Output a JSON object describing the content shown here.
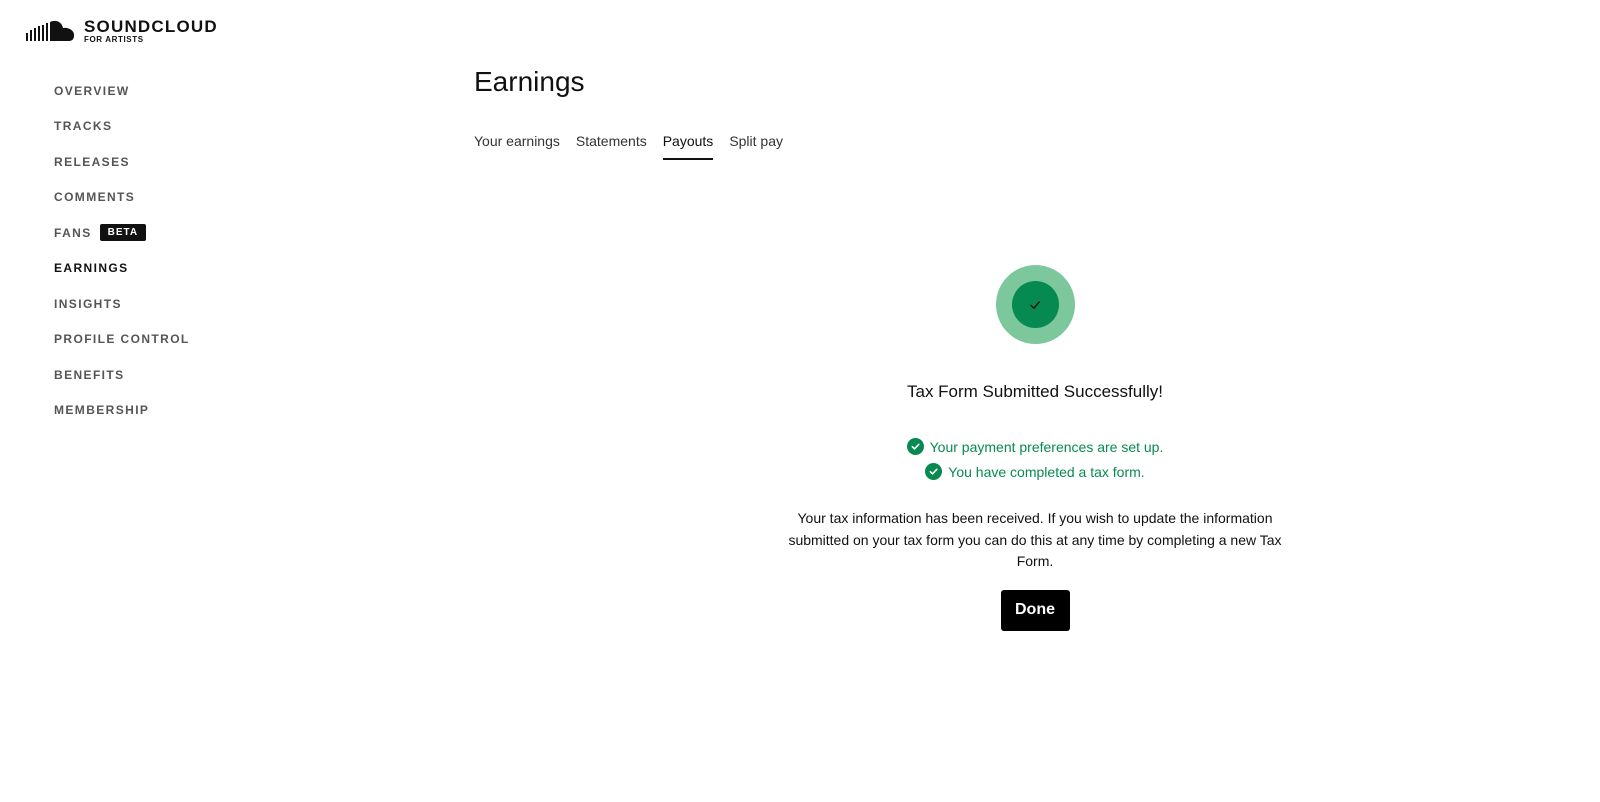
{
  "brand": {
    "logo_icon": "soundcloud-cloud-icon",
    "name": "SOUNDCLOUD",
    "subtitle": "FOR ARTISTS"
  },
  "sidebar": {
    "items": [
      {
        "label": "OVERVIEW",
        "active": false
      },
      {
        "label": "TRACKS",
        "active": false
      },
      {
        "label": "RELEASES",
        "active": false
      },
      {
        "label": "COMMENTS",
        "active": false
      },
      {
        "label": "FANS",
        "active": false,
        "badge": "BETA"
      },
      {
        "label": "EARNINGS",
        "active": true
      },
      {
        "label": "INSIGHTS",
        "active": false
      },
      {
        "label": "PROFILE CONTROL",
        "active": false
      },
      {
        "label": "BENEFITS",
        "active": false
      },
      {
        "label": "MEMBERSHIP",
        "active": false
      }
    ]
  },
  "main": {
    "title": "Earnings",
    "tabs": [
      {
        "label": "Your earnings",
        "active": false
      },
      {
        "label": "Statements",
        "active": false
      },
      {
        "label": "Payouts",
        "active": true
      },
      {
        "label": "Split pay",
        "active": false
      }
    ],
    "success": {
      "icon": "check-icon",
      "title": "Tax Form Submitted Successfully!",
      "status_items": [
        {
          "icon": "check-circle-icon",
          "text": "Your payment preferences are set up."
        },
        {
          "icon": "check-circle-icon",
          "text": "You have completed a tax form."
        }
      ],
      "info": "Your tax information has been received. If you wish to update the information submitted on your tax form you can do this at any time by completing a new Tax Form.",
      "done_label": "Done"
    }
  },
  "colors": {
    "success_green": "#078a52",
    "halo_green": "#7cc89c",
    "text_primary": "#111111",
    "badge_bg": "#111111"
  }
}
